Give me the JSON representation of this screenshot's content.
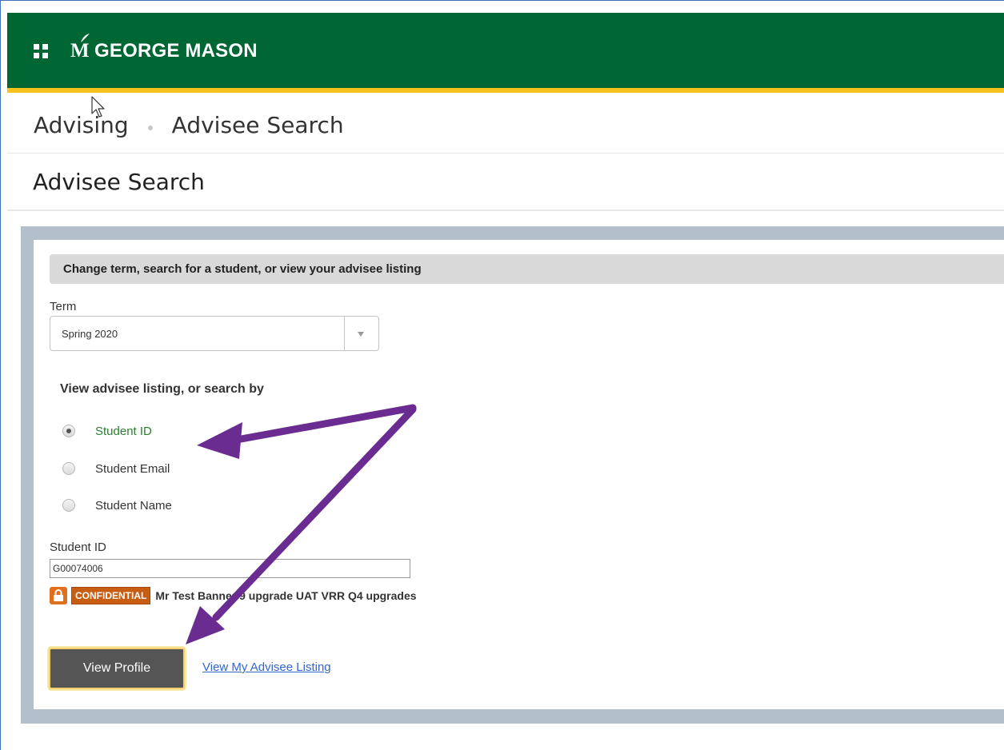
{
  "header": {
    "brand": "GEORGE MASON",
    "brand_mark": "M",
    "colors": {
      "green": "#006633",
      "gold": "#f7c21b"
    }
  },
  "breadcrumb": {
    "items": [
      "Advising",
      "Advisee Search"
    ]
  },
  "page": {
    "title": "Advisee Search"
  },
  "form": {
    "section_header": "Change term, search for a student, or view your advisee listing",
    "term_label": "Term",
    "term_value": "Spring 2020",
    "search_by_label": "View advisee listing, or search by",
    "search_options": [
      {
        "label": "Student ID",
        "checked": true
      },
      {
        "label": "Student Email",
        "checked": false
      },
      {
        "label": "Student Name",
        "checked": false
      }
    ],
    "student_id_label": "Student ID",
    "student_id_value": "G00074006",
    "confidential_badge": "CONFIDENTIAL",
    "student_name": "Mr Test Banner 9 upgrade UAT VRR Q4 upgrades",
    "view_profile_label": "View Profile",
    "advisee_listing_link": "View My Advisee Listing"
  },
  "annotations": {
    "arrow_color": "#6a2c91"
  }
}
